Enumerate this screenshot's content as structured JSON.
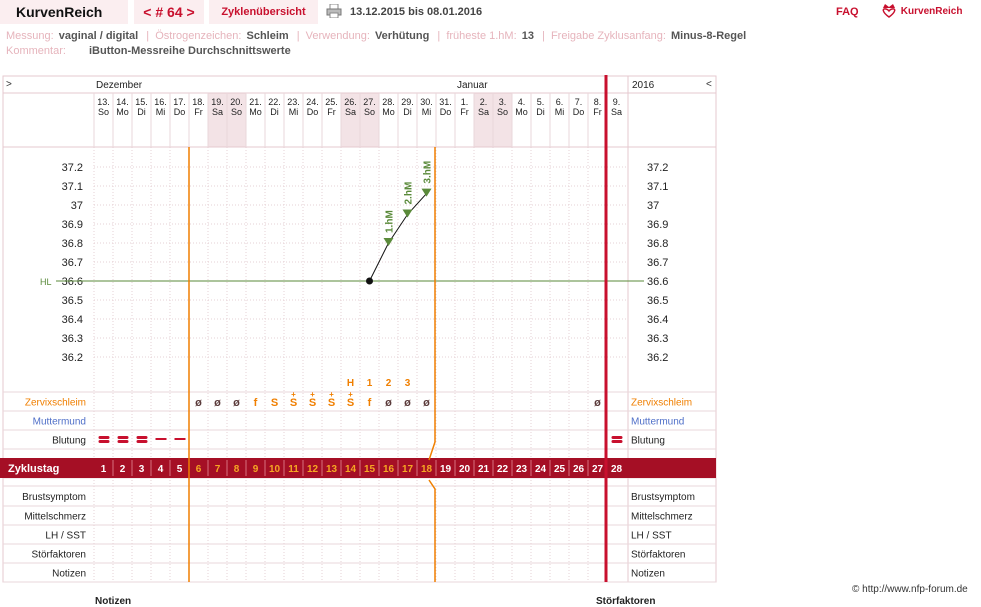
{
  "header": {
    "app_title": "KurvenReich",
    "cycle_nav": "< # 64 >",
    "overview_tab": "Zyklenübersicht",
    "date_range": "13.12.2015 bis 08.01.2016",
    "faq": "FAQ",
    "logo_text": "KurvenReich",
    "print_icon": "printer-icon",
    "logo_icon": "heart-crown-icon"
  },
  "meta": {
    "messung_label": "Messung:",
    "messung_value": "vaginal / digital",
    "oestrogen_label": "Östrogenzeichen:",
    "oestrogen_value": "Schleim",
    "verwendung_label": "Verwendung:",
    "verwendung_value": "Verhütung",
    "hm_label": "früheste 1.hM:",
    "hm_value": "13",
    "freigabe_label": "Freigabe Zyklusanfang:",
    "freigabe_value": "Minus-8-Regel",
    "kommentar_label": "Kommentar:",
    "kommentar_value": "iButton-Messreihe Durchschnittswerte"
  },
  "chart_data": {
    "type": "line",
    "title": "",
    "nav_left": ">",
    "nav_right": "<",
    "year": "2016",
    "months": [
      {
        "label": "Dezember",
        "at_day": 1
      },
      {
        "label": "Januar",
        "at_day": 20
      }
    ],
    "dates": [
      "13.",
      "14.",
      "15.",
      "16.",
      "17.",
      "18.",
      "19.",
      "20.",
      "21.",
      "22.",
      "23.",
      "24.",
      "25.",
      "26.",
      "27.",
      "28.",
      "29.",
      "30.",
      "31.",
      "1.",
      "2.",
      "3.",
      "4.",
      "5.",
      "6.",
      "7.",
      "8.",
      "9."
    ],
    "weekdays": [
      "So",
      "Mo",
      "Di",
      "Mi",
      "Do",
      "Fr",
      "Sa",
      "So",
      "Mo",
      "Di",
      "Mi",
      "Do",
      "Fr",
      "Sa",
      "So",
      "Mo",
      "Di",
      "Mi",
      "Do",
      "Fr",
      "Sa",
      "So",
      "Mo",
      "Di",
      "Mi",
      "Do",
      "Fr",
      "Sa"
    ],
    "weekend_days": [
      7,
      8,
      14,
      15,
      21,
      22
    ],
    "y_ticks": [
      "37.2",
      "37.1",
      "37",
      "36.9",
      "36.8",
      "36.7",
      "36.6",
      "36.5",
      "36.4",
      "36.3",
      "36.2"
    ],
    "ylim": [
      36.15,
      37.25
    ],
    "temperatures": [
      {
        "day": 15,
        "value": 36.6
      },
      {
        "day": 16,
        "value": 36.8
      },
      {
        "day": 17,
        "value": 36.95
      },
      {
        "day": 18,
        "value": 37.06
      }
    ],
    "highlights": [
      {
        "day": 16,
        "label": "1.hM"
      },
      {
        "day": 17,
        "label": "2.hM"
      },
      {
        "day": 18,
        "label": "3.hM"
      }
    ],
    "hl_label": "HL",
    "hl_value": 36.6,
    "peak_labels": [
      {
        "day": 14,
        "text": "H"
      },
      {
        "day": 15,
        "text": "1"
      },
      {
        "day": 16,
        "text": "2"
      },
      {
        "day": 17,
        "text": "3"
      }
    ],
    "schleim": [
      {
        "day": 6,
        "s": "ø"
      },
      {
        "day": 7,
        "s": "ø"
      },
      {
        "day": 8,
        "s": "ø"
      },
      {
        "day": 9,
        "s": "f"
      },
      {
        "day": 10,
        "s": "S"
      },
      {
        "day": 11,
        "s": "S+"
      },
      {
        "day": 12,
        "s": "S+"
      },
      {
        "day": 13,
        "s": "S+"
      },
      {
        "day": 14,
        "s": "S+"
      },
      {
        "day": 15,
        "s": "f"
      },
      {
        "day": 16,
        "s": "ø"
      },
      {
        "day": 17,
        "s": "ø"
      },
      {
        "day": 18,
        "s": "ø"
      },
      {
        "day": 27,
        "s": "ø"
      }
    ],
    "bleeding": [
      {
        "day": 1,
        "level": "heavy"
      },
      {
        "day": 2,
        "level": "heavy"
      },
      {
        "day": 3,
        "level": "heavy"
      },
      {
        "day": 4,
        "level": "light"
      },
      {
        "day": 5,
        "level": "light"
      },
      {
        "day": 28,
        "level": "heavy"
      }
    ],
    "cycle_label": "Zyklustag",
    "cycle_days": [
      "1",
      "2",
      "3",
      "4",
      "5",
      "6",
      "7",
      "8",
      "9",
      "10",
      "11",
      "12",
      "13",
      "14",
      "15",
      "16",
      "17",
      "18",
      "19",
      "20",
      "21",
      "22",
      "23",
      "24",
      "25",
      "26",
      "27",
      "28"
    ],
    "orange_days": [
      6,
      7,
      8,
      9,
      10,
      11,
      12,
      13,
      14,
      15,
      16,
      17,
      18
    ],
    "row_labels": {
      "zervix": "Zervixschleim",
      "muttermund": "Muttermund",
      "blutung": "Blutung",
      "brust": "Brustsymptom",
      "mittel": "Mittelschmerz",
      "lh": "LH / SST",
      "stoer": "Störfaktoren",
      "notizen": "Notizen"
    }
  },
  "colors": {
    "accent": "#c8102e",
    "bar": "#a50f25",
    "orange": "#f07f00",
    "green": "#5a8a3a",
    "blue": "#4f6fc8",
    "weekend": "#f3e3e6"
  },
  "footer": {
    "copyright": "© http://www.nfp-forum.de",
    "cut_left": "Notizen",
    "cut_right": "Störfaktoren"
  }
}
